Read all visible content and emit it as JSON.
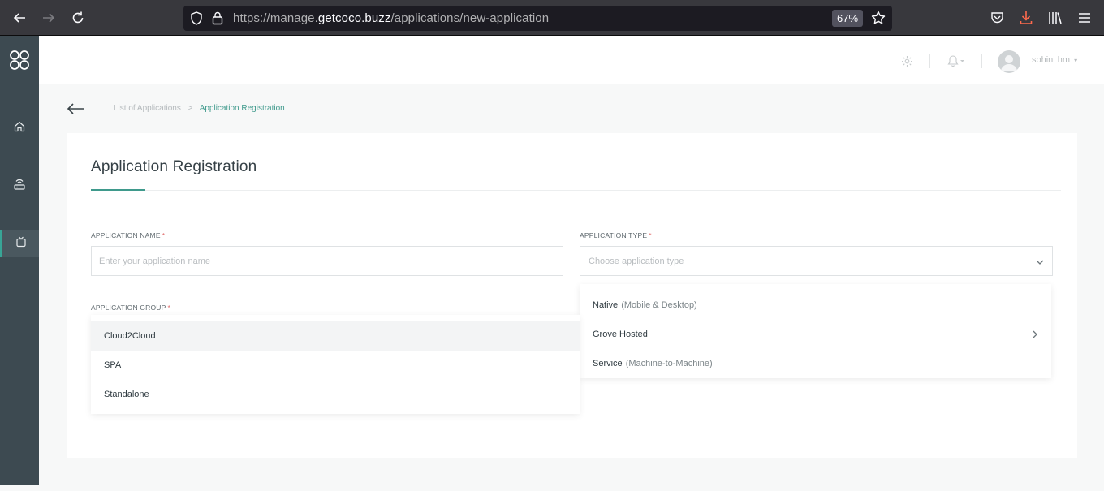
{
  "browser": {
    "url_prefix": "https://manage.",
    "url_domain": "getcoco.buzz",
    "url_path": "/applications/new-application",
    "zoom": "67%"
  },
  "header": {
    "user_name": "sohini hm"
  },
  "breadcrumb": {
    "parent": "List of Applications",
    "separator": ">",
    "current": "Application Registration"
  },
  "page": {
    "title": "Application Registration"
  },
  "form": {
    "app_name": {
      "label": "APPLICATION NAME",
      "required_mark": "*",
      "placeholder": "Enter your application name"
    },
    "app_type": {
      "label": "APPLICATION TYPE",
      "required_mark": "*",
      "placeholder": "Choose application type",
      "options": [
        {
          "name": "Native",
          "detail": "(Mobile & Desktop)"
        },
        {
          "name": "Grove Hosted",
          "detail": ""
        },
        {
          "name": "Service",
          "detail": "(Machine-to-Machine)"
        }
      ]
    },
    "app_group": {
      "label": "APPLICATION GROUP",
      "required_mark": "*",
      "options": [
        "Cloud2Cloud",
        "SPA",
        "Standalone"
      ]
    }
  },
  "colors": {
    "accent": "#3f9a8c",
    "sidebar": "#3d4a51",
    "required": "#e06c6c"
  },
  "icons": {
    "sidebar": [
      "coco-logo-icon",
      "home-icon",
      "hub-icon",
      "applications-icon"
    ],
    "header": [
      "settings-icon",
      "bell-icon",
      "user-avatar-icon"
    ]
  }
}
